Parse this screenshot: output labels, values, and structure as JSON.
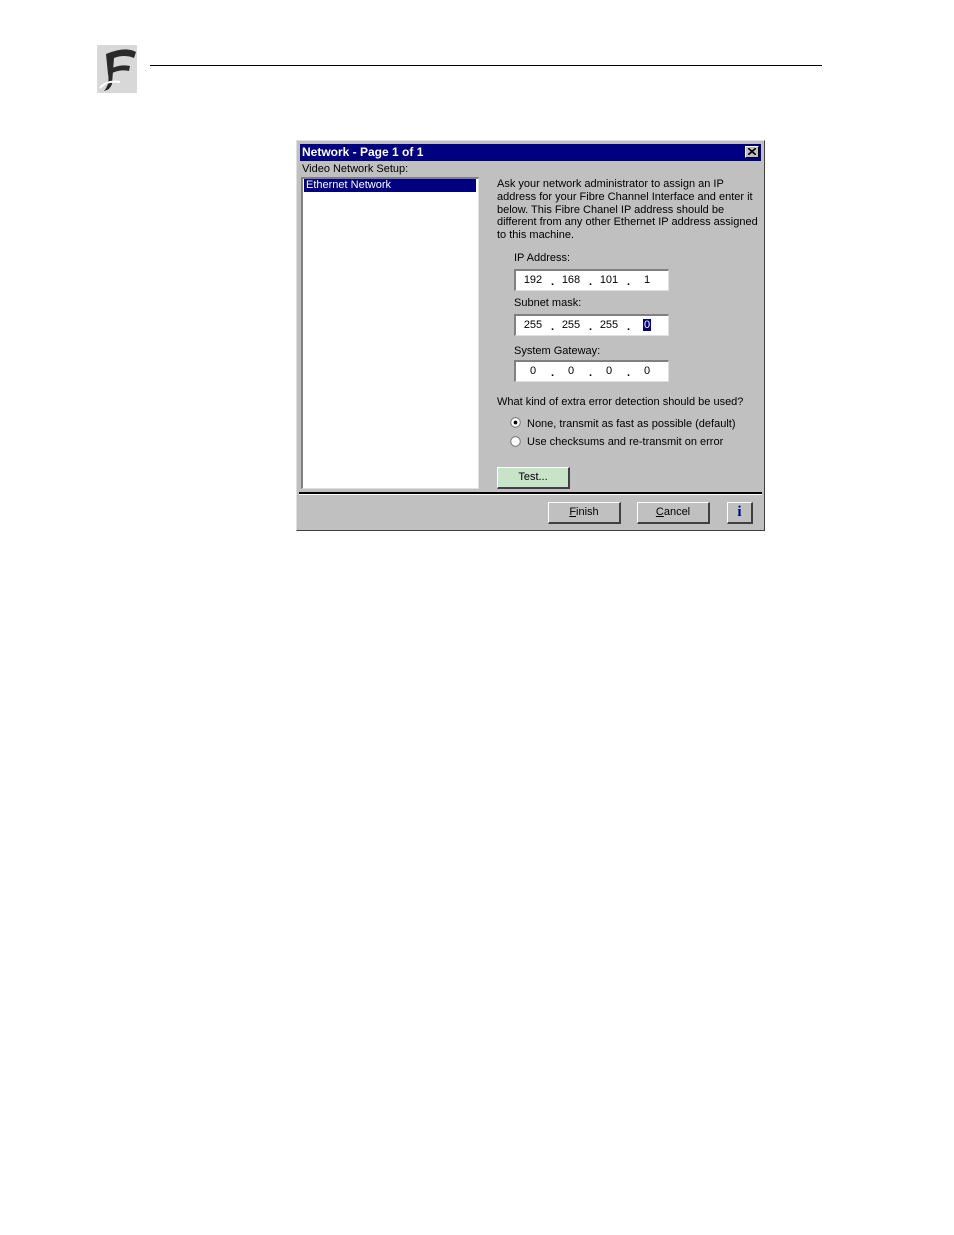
{
  "dialog": {
    "title": "Network - Page 1 of 1",
    "section_label": "Video Network Setup:",
    "list_items": [
      "Ethernet Network"
    ],
    "description": "Ask your network administrator to assign an IP address for your Fibre Channel Interface and enter it below. This Fibre Chanel IP address should be different from any other Ethernet IP address assigned to this machine.",
    "ip_address": {
      "label": "IP Address:",
      "octets": [
        "192",
        "168",
        "101",
        "1"
      ]
    },
    "subnet_mask": {
      "label": "Subnet mask:",
      "octets": [
        "255",
        "255",
        "255",
        "0"
      ]
    },
    "system_gateway": {
      "label": "System Gateway:",
      "octets": [
        "0",
        "0",
        "0",
        "0"
      ]
    },
    "error_detection": {
      "question": "What kind of extra error detection should be used?",
      "options": [
        {
          "label": "None, transmit as fast as possible (default)",
          "selected": true
        },
        {
          "label": "Use checksums and re-transmit on error",
          "selected": false
        }
      ]
    },
    "buttons": {
      "test": "Test...",
      "finish_first": "F",
      "finish_rest": "inish",
      "cancel_first": "C",
      "cancel_rest": "ancel",
      "info": "i"
    }
  },
  "colors": {
    "titlebar": "#000080",
    "dialog_face": "#c0c0c0",
    "test_button": "#c8e4c8"
  }
}
